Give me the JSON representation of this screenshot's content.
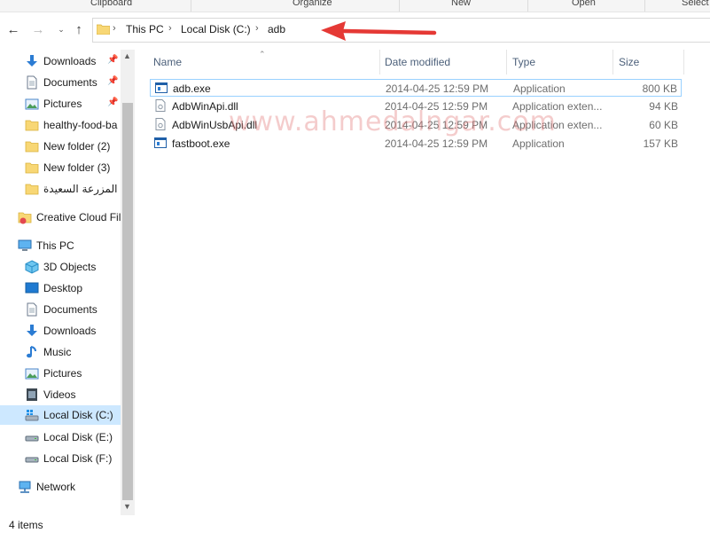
{
  "ribbon": {
    "groups": [
      "Clipboard",
      "Organize",
      "New",
      "Open",
      "Select"
    ]
  },
  "address": {
    "crumbs": [
      "This PC",
      "Local Disk (C:)",
      "adb"
    ]
  },
  "sidebar": {
    "quick_access": [
      {
        "label": "Downloads",
        "icon": "download-arrow-icon",
        "pinned": true
      },
      {
        "label": "Documents",
        "icon": "document-icon",
        "pinned": true
      },
      {
        "label": "Pictures",
        "icon": "pictures-icon",
        "pinned": true
      },
      {
        "label": "healthy-food-ba",
        "icon": "folder-icon",
        "pinned": false
      },
      {
        "label": "New folder (2)",
        "icon": "folder-icon",
        "pinned": false
      },
      {
        "label": "New folder (3)",
        "icon": "folder-icon",
        "pinned": false
      },
      {
        "label": "المزرعة السعيدة",
        "icon": "folder-icon",
        "pinned": false
      }
    ],
    "creative_cloud": "Creative Cloud Fil",
    "this_pc": "This PC",
    "pc_items": [
      {
        "label": "3D Objects",
        "icon": "cube-icon"
      },
      {
        "label": "Desktop",
        "icon": "desktop-icon"
      },
      {
        "label": "Documents",
        "icon": "document-icon"
      },
      {
        "label": "Downloads",
        "icon": "download-arrow-icon"
      },
      {
        "label": "Music",
        "icon": "music-note-icon"
      },
      {
        "label": "Pictures",
        "icon": "pictures-icon"
      },
      {
        "label": "Videos",
        "icon": "video-icon"
      },
      {
        "label": "Local Disk (C:)",
        "icon": "drive-icon",
        "selected": true
      },
      {
        "label": "Local Disk (E:)",
        "icon": "drive-icon"
      },
      {
        "label": "Local Disk (F:)",
        "icon": "drive-icon"
      }
    ],
    "network": "Network"
  },
  "columns": {
    "name": "Name",
    "date": "Date modified",
    "type": "Type",
    "size": "Size"
  },
  "files": [
    {
      "name": "adb.exe",
      "date": "2014-04-25 12:59 PM",
      "type": "Application",
      "size": "800 KB",
      "icon": "exe-icon",
      "selected": true
    },
    {
      "name": "AdbWinApi.dll",
      "date": "2014-04-25 12:59 PM",
      "type": "Application exten...",
      "size": "94 KB",
      "icon": "dll-icon"
    },
    {
      "name": "AdbWinUsbApi.dll",
      "date": "2014-04-25 12:59 PM",
      "type": "Application exten...",
      "size": "60 KB",
      "icon": "dll-icon"
    },
    {
      "name": "fastboot.exe",
      "date": "2014-04-25 12:59 PM",
      "type": "Application",
      "size": "157 KB",
      "icon": "exe-icon"
    }
  ],
  "watermark": "www.ahmedalngar.com",
  "status": {
    "count": "4 items"
  },
  "colors": {
    "selection": "#cde8ff",
    "accent_arrow": "#e53935",
    "folder": "#f8d775"
  }
}
